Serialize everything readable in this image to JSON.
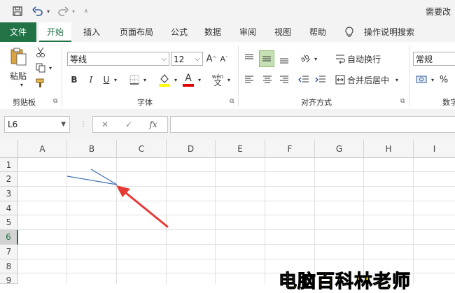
{
  "quick_access": {
    "doc_title": "需要改"
  },
  "tabs": [
    {
      "label": "文件"
    },
    {
      "label": "开始"
    },
    {
      "label": "插入"
    },
    {
      "label": "页面布局"
    },
    {
      "label": "公式"
    },
    {
      "label": "数据"
    },
    {
      "label": "审阅"
    },
    {
      "label": "视图"
    },
    {
      "label": "帮助"
    },
    {
      "label": "操作说明搜索"
    }
  ],
  "ribbon": {
    "clipboard": {
      "paste_label": "粘贴",
      "group_label": "剪贴板"
    },
    "font": {
      "font_name": "等线",
      "font_size": "12",
      "bold": "B",
      "italic": "I",
      "underline": "U",
      "grow": "A",
      "shrink": "A",
      "font_color_glyph": "A",
      "phonetic": "wén",
      "group_label": "字体"
    },
    "alignment": {
      "wrap_label": "自动换行",
      "merge_label": "合并后居中",
      "group_label": "对齐方式"
    },
    "number": {
      "format": "常规",
      "percent": "%",
      "group_label": "数字"
    }
  },
  "formula_bar": {
    "name_box": "L6",
    "cancel": "✕",
    "enter": "✓",
    "fx": "fx",
    "value": ""
  },
  "grid": {
    "columns": [
      "A",
      "B",
      "C",
      "D",
      "E",
      "F",
      "G",
      "H",
      "I"
    ],
    "rows": [
      "1",
      "2",
      "3",
      "4",
      "5",
      "6",
      "7",
      "8",
      "9"
    ],
    "active_row": "6"
  },
  "colors": {
    "accent": "#217346",
    "arrow": "#e53935",
    "line": "#3f6fb5",
    "watermark": "#ffe600"
  },
  "watermark": "电脑百科林老师"
}
